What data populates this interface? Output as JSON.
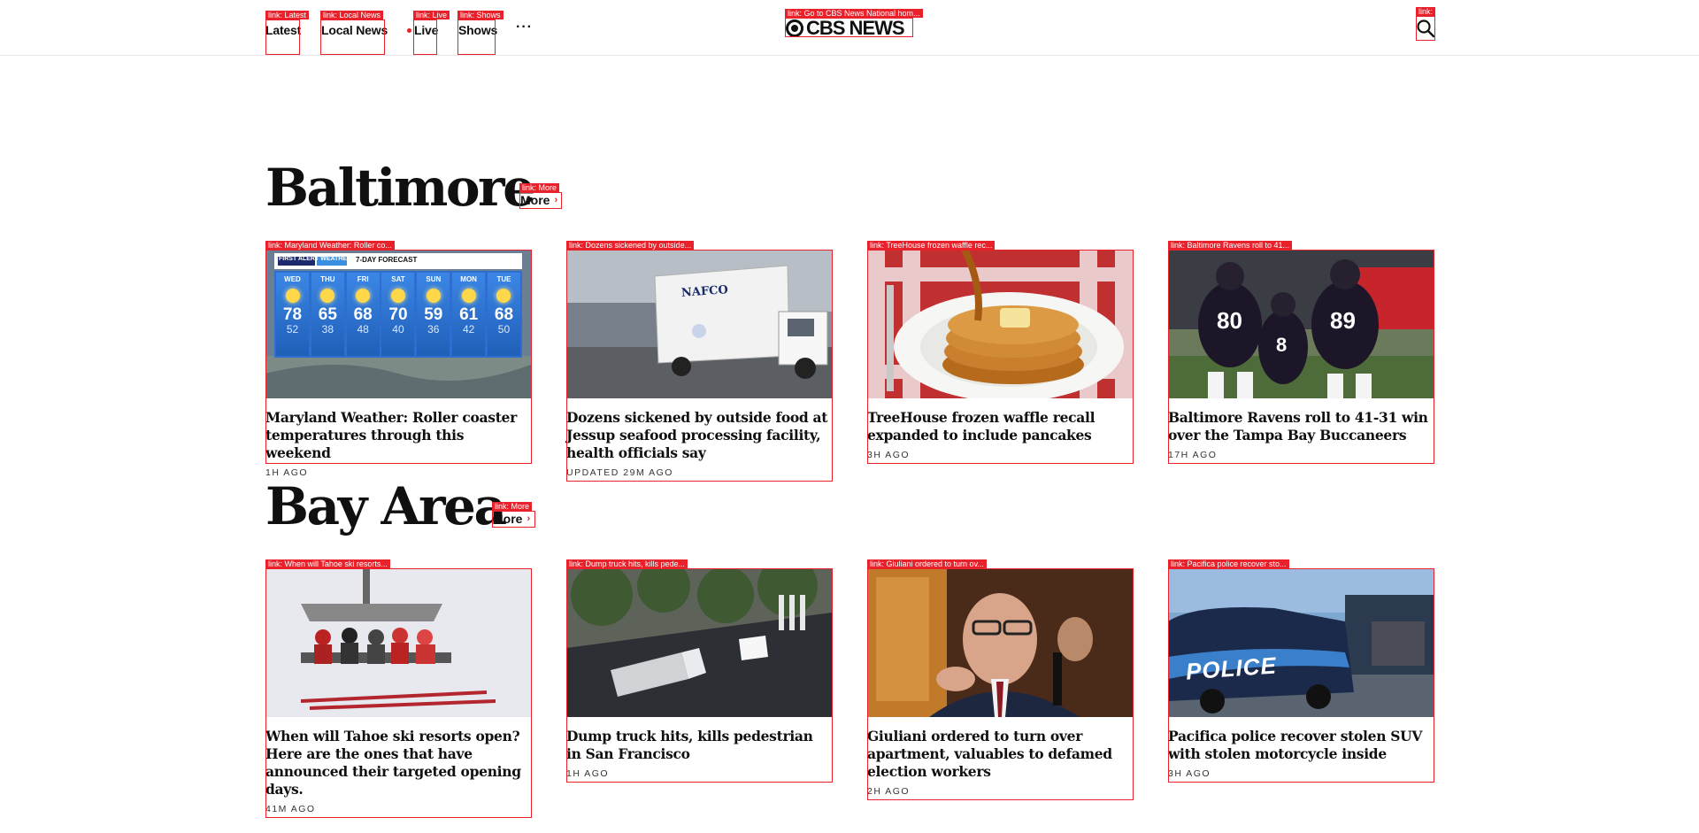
{
  "header": {
    "nav": [
      {
        "label": "Latest",
        "anno": "link: Latest"
      },
      {
        "label": "Local News",
        "anno": "link: Local News"
      },
      {
        "label": "Live",
        "anno": "link: Live"
      },
      {
        "label": "Shows",
        "anno": "link: Shows"
      }
    ],
    "more_label": "···",
    "logo": {
      "text": "CBS NEWS",
      "anno": "link: Go to CBS News National hom..."
    },
    "search_anno": "link:"
  },
  "sections": [
    {
      "title": "Baltimore",
      "more_label": "More",
      "more_anno": "link: More",
      "cards": [
        {
          "title": "Maryland Weather: Roller coaster temperatures through this weekend",
          "time": "1H AGO",
          "anno": "link: Maryland Weather: Roller co...",
          "image": "weather-forecast-image"
        },
        {
          "title": "Dozens sickened by outside food at Jessup seafood processing facility, health officials say",
          "time": "UPDATED 29M AGO",
          "anno": "link: Dozens sickened by outside...",
          "image": "truck-image"
        },
        {
          "title": "TreeHouse frozen waffle recall expanded to include pancakes",
          "time": "3H AGO",
          "anno": "link: TreeHouse frozen waffle rec...",
          "image": "pancakes-image"
        },
        {
          "title": "Baltimore Ravens roll to 41-31 win over the Tampa Bay Buccaneers",
          "time": "17H AGO",
          "anno": "link: Baltimore Ravens roll to 41...",
          "image": "ravens-players-image"
        }
      ]
    },
    {
      "title": "Bay Area",
      "more_label": "More",
      "more_anno": "link: More",
      "cards": [
        {
          "title": "When will Tahoe ski resorts open? Here are the ones that have announced their targeted opening days.",
          "time": "41M AGO",
          "anno": "link: When will Tahoe ski resorts...",
          "image": "ski-lift-image"
        },
        {
          "title": "Dump truck hits, kills pedestrian in San Francisco",
          "time": "1H AGO",
          "anno": "link: Dump truck hits, kills pede...",
          "image": "dump-truck-aerial-image"
        },
        {
          "title": "Giuliani ordered to turn over apartment, valuables to defamed election workers",
          "time": "2H AGO",
          "anno": "link: Giuliani ordered to turn ov...",
          "image": "giuliani-image"
        },
        {
          "title": "Pacifica police recover stolen SUV with stolen motorcycle inside",
          "time": "3H AGO",
          "anno": "link: Pacifica police recover sto...",
          "image": "police-car-image"
        }
      ]
    }
  ],
  "weather_graphic": {
    "header": "FIRST ALERT WEATHER",
    "subheader": "7-DAY FORECAST",
    "days": [
      {
        "d": "WED",
        "hi": "78",
        "lo": "52"
      },
      {
        "d": "THU",
        "hi": "65",
        "lo": "38"
      },
      {
        "d": "FRI",
        "hi": "68",
        "lo": "48"
      },
      {
        "d": "SAT",
        "hi": "70",
        "lo": "40"
      },
      {
        "d": "SUN",
        "hi": "59",
        "lo": "36"
      },
      {
        "d": "MON",
        "hi": "61",
        "lo": "42"
      },
      {
        "d": "TUE",
        "hi": "68",
        "lo": "50"
      }
    ]
  },
  "truck_sign": "NAFCO",
  "police_sign": "POLICE",
  "jersey_numbers": [
    "80",
    "8",
    "89"
  ],
  "colors": {
    "accent": "#e8212b",
    "text": "#101010"
  }
}
